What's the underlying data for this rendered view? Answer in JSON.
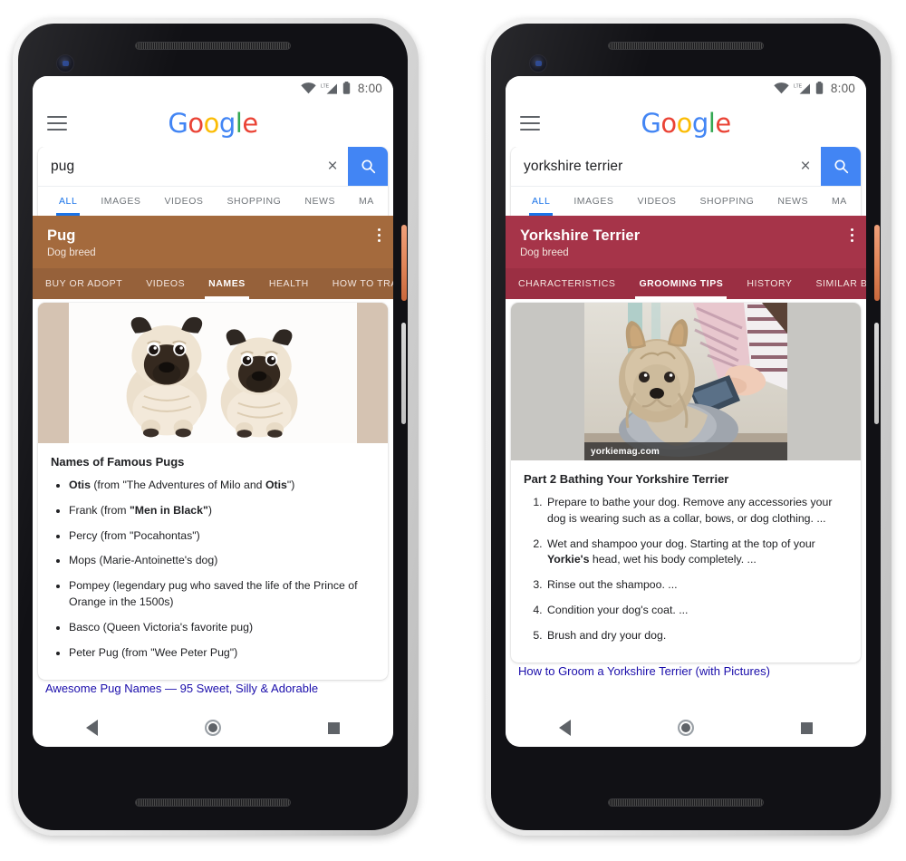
{
  "phones": [
    {
      "id": "pug",
      "status_bar": {
        "time": "8:00",
        "wifi": "wifi-icon",
        "signal": "lte-signal-icon",
        "battery": "battery-icon"
      },
      "header": {
        "menu": "hamburger-menu-icon",
        "logo_parts": [
          "G",
          "o",
          "o",
          "g",
          "l",
          "e"
        ]
      },
      "search": {
        "query": "pug",
        "placeholder": "Search",
        "clear": "×",
        "go_icon": "search-icon"
      },
      "search_tabs": [
        {
          "label": "ALL",
          "active": true
        },
        {
          "label": "IMAGES",
          "active": false
        },
        {
          "label": "VIDEOS",
          "active": false
        },
        {
          "label": "SHOPPING",
          "active": false
        },
        {
          "label": "NEWS",
          "active": false
        },
        {
          "label": "MA",
          "active": false
        }
      ],
      "knowledge_panel": {
        "title": "Pug",
        "subtitle": "Dog breed",
        "accent_header": "#a46a3d",
        "accent_tabs": "#96613a",
        "more_icon": "overflow-menu-icon",
        "tabs": [
          {
            "label": "BUY OR ADOPT",
            "active": false
          },
          {
            "label": "VIDEOS",
            "active": false
          },
          {
            "label": "NAMES",
            "active": true
          },
          {
            "label": "HEALTH",
            "active": false
          },
          {
            "label": "HOW TO TRAIN",
            "active": false
          }
        ]
      },
      "hero": {
        "type": "photo",
        "alt": "two-pugs-photo",
        "side_color": "#d5c3b2"
      },
      "body": {
        "title": "Names of Famous Pugs",
        "list_type": "bullet",
        "items": [
          "<b>Otis</b> (from \"The Adventures of Milo and <b>Otis</b>\")",
          "Frank (from <b>\"Men in Black\"</b>)",
          "Percy (from \"Pocahontas\")",
          "Mops (Marie-Antoinette's dog)",
          "Pompey (legendary pug who saved the life of the Prince of Orange in the 1500s)",
          "Basco (Queen Victoria's favorite pug)",
          "Peter Pug (from \"Wee Peter Pug\")"
        ]
      },
      "next_link": "Awesome Pug Names — 95 Sweet, Silly & Adorable",
      "navbar": {
        "back": "back-triangle-icon",
        "home": "home-circle-icon",
        "recents": "recents-square-icon"
      }
    },
    {
      "id": "yorkshire-terrier",
      "status_bar": {
        "time": "8:00",
        "wifi": "wifi-icon",
        "signal": "lte-signal-icon",
        "battery": "battery-icon"
      },
      "header": {
        "menu": "hamburger-menu-icon",
        "logo_parts": [
          "G",
          "o",
          "o",
          "g",
          "l",
          "e"
        ]
      },
      "search": {
        "query": "yorkshire terrier",
        "placeholder": "Search",
        "clear": "×",
        "go_icon": "search-icon"
      },
      "search_tabs": [
        {
          "label": "ALL",
          "active": true
        },
        {
          "label": "IMAGES",
          "active": false
        },
        {
          "label": "VIDEOS",
          "active": false
        },
        {
          "label": "SHOPPING",
          "active": false
        },
        {
          "label": "NEWS",
          "active": false
        },
        {
          "label": "MA",
          "active": false
        }
      ],
      "knowledge_panel": {
        "title": "Yorkshire Terrier",
        "subtitle": "Dog breed",
        "accent_header": "#a63449",
        "accent_tabs": "#9b2f43",
        "more_icon": "overflow-menu-icon",
        "tabs": [
          {
            "label": "CHARACTERISTICS",
            "active": false
          },
          {
            "label": "GROOMING TIPS",
            "active": true
          },
          {
            "label": "HISTORY",
            "active": false
          },
          {
            "label": "SIMILAR BRE",
            "active": false
          }
        ]
      },
      "hero": {
        "type": "photo",
        "alt": "yorkie-being-brushed-photo",
        "credit": "yorkiemag.com",
        "side_color": "#c7c6c2"
      },
      "body": {
        "title": "Part 2 Bathing Your Yorkshire Terrier",
        "list_type": "numbered",
        "items": [
          "Prepare to bathe your dog. Remove any accessories your dog is wearing such as a collar, bows, or dog clothing. ...",
          "Wet and shampoo your dog. Starting at the top of your <b>Yorkie's</b> head, wet his body completely. ...",
          "Rinse out the shampoo. ...",
          "Condition your dog's coat. ...",
          "Brush and dry your dog."
        ]
      },
      "next_link": "How to Groom a Yorkshire Terrier (with Pictures)",
      "navbar": {
        "back": "back-triangle-icon",
        "home": "home-circle-icon",
        "recents": "recents-square-icon"
      }
    }
  ]
}
